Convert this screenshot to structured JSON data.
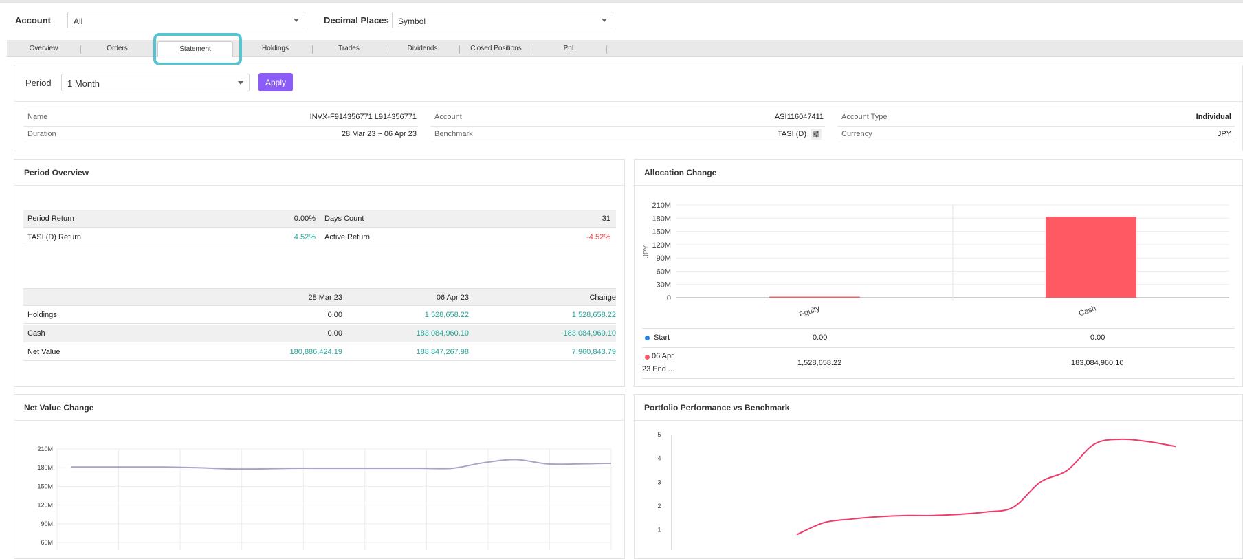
{
  "topbar": {
    "account_label": "Account",
    "account_value": "All",
    "decimal_label": "Decimal Places",
    "decimal_value": "Symbol"
  },
  "tabs": [
    {
      "label": "Overview"
    },
    {
      "label": "Orders"
    },
    {
      "label": "Statement",
      "active": true
    },
    {
      "label": "Holdings"
    },
    {
      "label": "Trades"
    },
    {
      "label": "Dividends"
    },
    {
      "label": "Closed Positions"
    },
    {
      "label": "PnL"
    }
  ],
  "period": {
    "label": "Period",
    "value": "1 Month",
    "apply_label": "Apply"
  },
  "info": {
    "name_label": "Name",
    "name_value": "INVX-F914356771 L914356771",
    "duration_label": "Duration",
    "duration_value": "28 Mar 23 ~ 06 Apr 23",
    "account_label": "Account",
    "account_value": "ASI116047411",
    "benchmark_label": "Benchmark",
    "benchmark_value": "TASI (D)",
    "account_type_label": "Account Type",
    "account_type_value": "Individual",
    "currency_label": "Currency",
    "currency_value": "JPY"
  },
  "period_overview": {
    "title": "Period Overview",
    "period_return_label": "Period Return",
    "period_return_value": "0.00%",
    "days_count_label": "Days Count",
    "days_count_value": "31",
    "tasi_return_label": "TASI (D) Return",
    "tasi_return_value": "4.52%",
    "active_return_label": "Active Return",
    "active_return_value": "-4.52%",
    "columns": [
      "28 Mar 23",
      "06 Apr 23",
      "Change"
    ],
    "rows": [
      {
        "label": "Holdings",
        "start": "0.00",
        "end": "1,528,658.22",
        "change": "1,528,658.22"
      },
      {
        "label": "Cash",
        "start": "0.00",
        "end": "183,084,960.10",
        "change": "183,084,960.10"
      },
      {
        "label": "Net Value",
        "start": "180,886,424.19",
        "end": "188,847,267.98",
        "change": "7,960,843.79"
      }
    ]
  },
  "allocation": {
    "title": "Allocation Change",
    "legend": [
      {
        "label": "Start",
        "color": "#1e88e5",
        "equity": "0.00",
        "cash": "0.00"
      },
      {
        "label": "06 Apr 23 End ...",
        "label_line1": "06 Apr",
        "label_line2": "23 End ...",
        "color": "#ff5a64",
        "equity": "1,528,658.22",
        "cash": "183,084,960.10"
      }
    ]
  },
  "net_value_change": {
    "title": "Net Value Change"
  },
  "performance": {
    "title": "Portfolio Performance vs Benchmark"
  },
  "chart_data": [
    {
      "type": "bar",
      "ylabel": "JPY",
      "categories": [
        "Equity",
        "Cash"
      ],
      "series": [
        {
          "name": "Start",
          "color": "#1e88e5",
          "values": [
            0,
            0
          ]
        },
        {
          "name": "06 Apr 23 End ...",
          "color": "#ff5a64",
          "values": [
            1528658.22,
            183084960.1
          ]
        }
      ],
      "ylim": [
        0,
        210000000
      ],
      "yticks": [
        "0",
        "30M",
        "60M",
        "90M",
        "120M",
        "150M",
        "180M",
        "210M"
      ]
    },
    {
      "type": "line",
      "series": [
        {
          "color": "#a8a4c4",
          "values": [
            181,
            181,
            181,
            181,
            180,
            178,
            178,
            179,
            179,
            179,
            179,
            179,
            179,
            188,
            193,
            186,
            186,
            187
          ]
        }
      ],
      "ylim": [
        60,
        210
      ],
      "yticks": [
        "60M",
        "90M",
        "120M",
        "150M",
        "180M",
        "210M"
      ],
      "grid": true
    },
    {
      "type": "line",
      "series": [
        {
          "color": "#ef3d6b",
          "values": [
            0.8,
            1.3,
            1.45,
            1.55,
            1.6,
            1.6,
            1.65,
            1.75,
            1.95,
            3.0,
            3.5,
            4.6,
            4.8,
            4.7,
            4.5
          ]
        }
      ],
      "ylim": [
        0.5,
        5
      ],
      "yticks": [
        "1",
        "2",
        "3",
        "4",
        "5"
      ]
    }
  ]
}
